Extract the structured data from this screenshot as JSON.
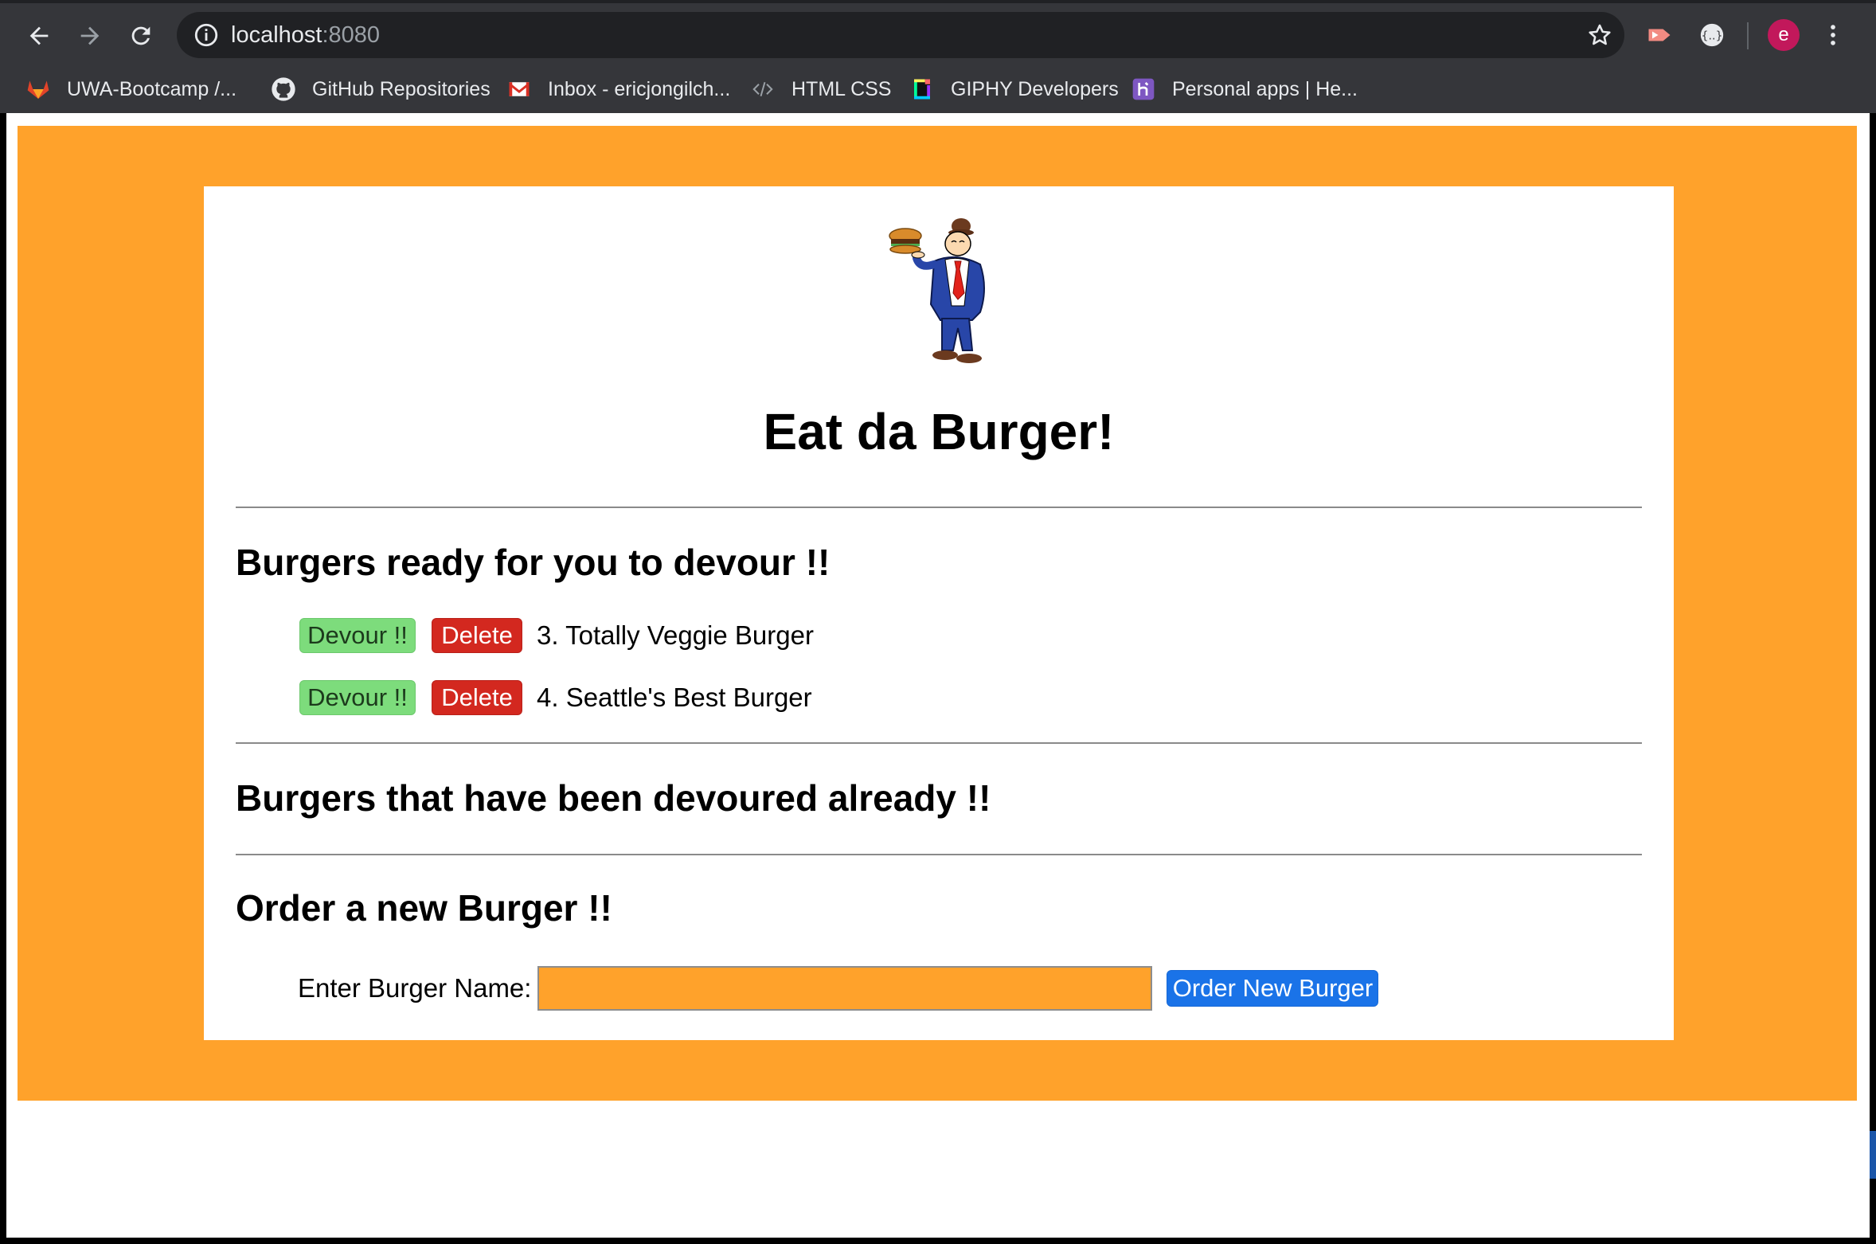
{
  "browser": {
    "url_host": "localhost",
    "url_port": ":8080",
    "icons": {
      "back": "arrow-left-icon",
      "forward": "arrow-right-icon",
      "reload": "reload-icon",
      "info": "info-icon",
      "star": "star-icon",
      "menu": "more-vert-icon"
    },
    "avatar_letter": "e",
    "bookmarks": [
      {
        "label": "UWA-Bootcamp /...",
        "icon": "gitlab-icon"
      },
      {
        "label": "GitHub Repositories",
        "icon": "github-icon"
      },
      {
        "label": "Inbox - ericjongilch...",
        "icon": "gmail-icon"
      },
      {
        "label": "HTML CSS",
        "icon": "code-icon"
      },
      {
        "label": "GIPHY Developers",
        "icon": "giphy-icon"
      },
      {
        "label": "Personal apps | He...",
        "icon": "heroku-icon"
      }
    ]
  },
  "page": {
    "title": "Eat da Burger!",
    "ready_heading": "Burgers ready for you to devour !!",
    "devoured_heading": "Burgers that have been devoured already !!",
    "order_heading": "Order a new Burger !!",
    "ready_burgers": [
      {
        "devour_label": "Devour !!",
        "delete_label": "Delete",
        "name": "3. Totally Veggie Burger"
      },
      {
        "devour_label": "Devour !!",
        "delete_label": "Delete",
        "name": "4. Seattle's Best Burger"
      }
    ],
    "order": {
      "label": "Enter Burger Name:",
      "input_value": "",
      "button_label": "Order New Burger"
    }
  },
  "colors": {
    "accent_orange": "#ffa22b",
    "devour_green": "#7ddc7c",
    "delete_red": "#d3281f",
    "order_blue": "#1a73e8"
  }
}
